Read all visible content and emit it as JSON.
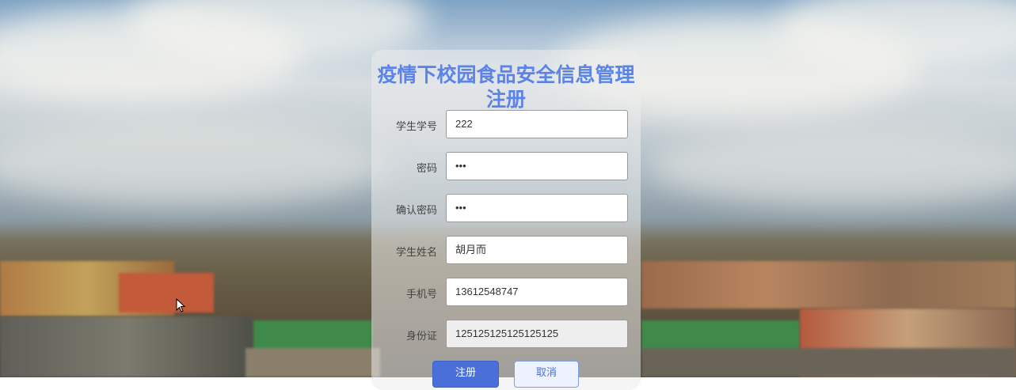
{
  "page": {
    "title_line1": "疫情下校园食品安全信息管理",
    "title_line2": "注册",
    "accent_color": "#5c84e6"
  },
  "form": {
    "fields": [
      {
        "label": "学生学号",
        "value": "222"
      },
      {
        "label": "密码",
        "value": "•••"
      },
      {
        "label": "确认密码",
        "value": "•••"
      },
      {
        "label": "学生姓名",
        "value": "胡月而"
      },
      {
        "label": "手机号",
        "value": "13612548747"
      },
      {
        "label": "身份证",
        "value": "125125125125125125"
      }
    ],
    "submit_label": "注册",
    "cancel_label": "取消"
  }
}
